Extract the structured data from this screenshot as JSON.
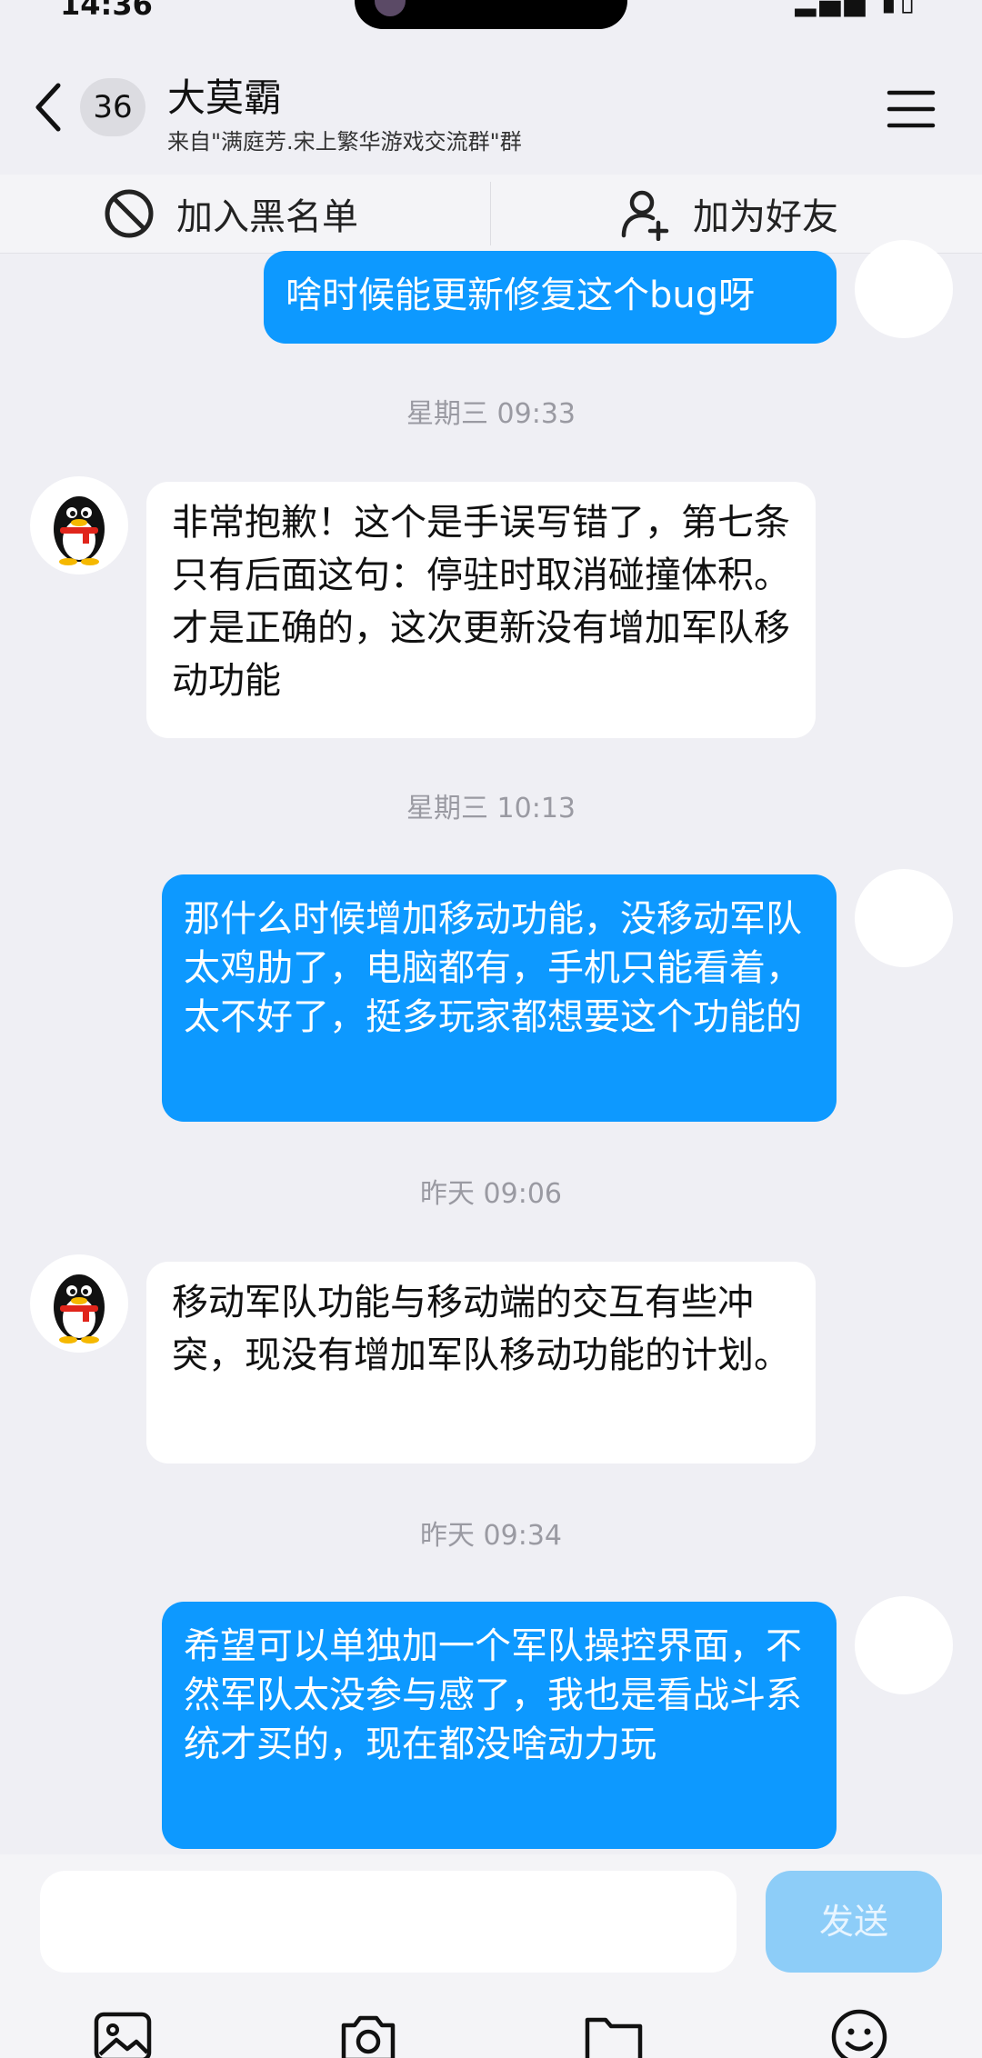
{
  "status_bar": {
    "time": "14:36"
  },
  "header": {
    "unread_count": "36",
    "title": "大莫霸",
    "subtitle": "来自\"满庭芳.宋上繁华游戏交流群\"群"
  },
  "actions": {
    "block_label": "加入黑名单",
    "add_friend_label": "加为好友"
  },
  "messages": [
    {
      "type": "outgoing",
      "text": "啥时候能更新修复这个bug呀"
    },
    {
      "type": "timestamp",
      "text": "星期三 09:33"
    },
    {
      "type": "incoming",
      "text": "非常抱歉！这个是手误写错了，第七条只有后面这句：停驻时取消碰撞体积。才是正确的，这次更新没有增加军队移动功能"
    },
    {
      "type": "timestamp",
      "text": "星期三 10:13"
    },
    {
      "type": "outgoing",
      "text": "那什么时候增加移动功能，没移动军队太鸡肋了，电脑都有，手机只能看着，太不好了，挺多玩家都想要这个功能的"
    },
    {
      "type": "timestamp",
      "text": "昨天 09:06"
    },
    {
      "type": "incoming",
      "text": "移动军队功能与移动端的交互有些冲突，现没有增加军队移动功能的计划。"
    },
    {
      "type": "timestamp",
      "text": "昨天 09:34"
    },
    {
      "type": "outgoing",
      "text": "希望可以单独加一个军队操控界面，不然军队太没参与感了，我也是看战斗系统才买的，现在都没啥动力玩"
    }
  ],
  "input": {
    "value": "",
    "send_label": "发送"
  },
  "toolbar": {
    "icons": [
      "image-icon",
      "camera-icon",
      "folder-icon",
      "emoji-icon"
    ]
  },
  "colors": {
    "background": "#efeff4",
    "outgoing_bubble": "#0d99ff",
    "incoming_bubble": "#ffffff",
    "send_button_disabled": "#8dcdf8",
    "timestamp": "#9a9aa2"
  }
}
